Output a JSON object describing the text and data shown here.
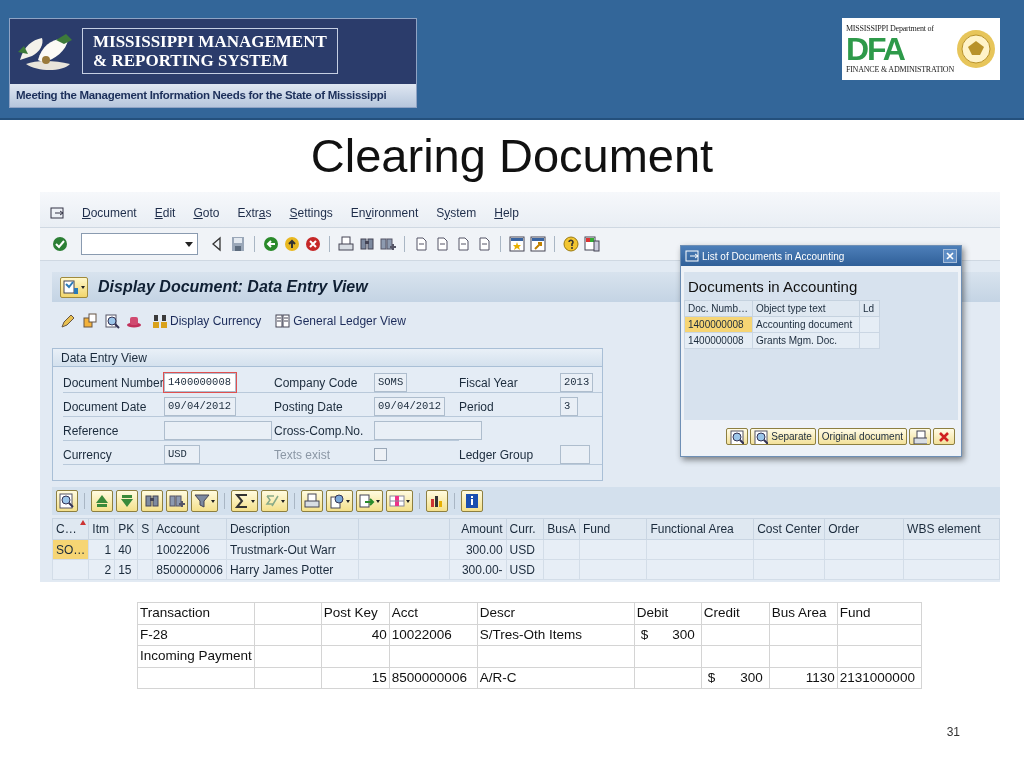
{
  "banner": {
    "title_lines": [
      "MISSISSIPPI MANAGEMENT",
      "& REPORTING SYSTEM"
    ],
    "tagline": "Meeting the Management Information Needs for the State of Mississippi"
  },
  "dfa_logo": {
    "top": "MISSISSIPPI Department of",
    "letters": "DFA",
    "bottom": "FINANCE & ADMINISTRATION"
  },
  "slide_title": "Clearing Document",
  "sap": {
    "menu": [
      {
        "label": "Document"
      },
      {
        "label": "Edit"
      },
      {
        "label": "Goto"
      },
      {
        "label": "Extras"
      },
      {
        "label": "Settings"
      },
      {
        "label": "Environment"
      },
      {
        "label": "System"
      },
      {
        "label": "Help"
      }
    ],
    "screen_title": "Display Document: Data Entry View",
    "app_toolbar": [
      {
        "label": "Display Currency"
      },
      {
        "label": "General Ledger View"
      }
    ],
    "group": {
      "title": "Data Entry View",
      "rows": [
        [
          {
            "kind": "field",
            "label": "Document Number",
            "value": "1400000008",
            "focused": true
          },
          {
            "kind": "field",
            "label": "Company Code",
            "value": "SOMS",
            "focused": false
          },
          {
            "kind": "field",
            "label": "Fiscal Year",
            "value": "2013",
            "focused": false
          }
        ],
        [
          {
            "kind": "field",
            "label": "Document Date",
            "value": "09/04/2012",
            "focused": false
          },
          {
            "kind": "field",
            "label": "Posting Date",
            "value": "09/04/2012",
            "focused": false
          },
          {
            "kind": "field",
            "label": "Period",
            "value": "3",
            "focused": false
          }
        ],
        [
          {
            "kind": "field",
            "label": "Reference",
            "focused": false
          },
          {
            "kind": "field",
            "label": "Cross-Comp.No.",
            "focused": false
          }
        ],
        [
          {
            "kind": "field",
            "label": "Currency",
            "value": "USD",
            "focused": false
          },
          {
            "kind": "checkbox",
            "label": "Texts exist",
            "checked": false,
            "disabled": true
          },
          {
            "kind": "field",
            "label": "Ledger Group",
            "focused": false
          }
        ]
      ]
    },
    "grid": {
      "columns": [
        {
          "label": "C…",
          "sorted": true
        },
        {
          "label": "Itm",
          "sorted": false
        },
        {
          "label": "PK",
          "sorted": false
        },
        {
          "label": "S",
          "sorted": false
        },
        {
          "label": "Account",
          "sorted": false
        },
        {
          "label": "Description",
          "sorted": false
        },
        {
          "sorted": false
        },
        {
          "label": "Amount",
          "sorted": false
        },
        {
          "label": "Curr.",
          "sorted": false
        },
        {
          "label": "BusA",
          "sorted": false
        },
        {
          "label": "Fund",
          "sorted": false
        },
        {
          "label": "Functional Area",
          "sorted": false
        },
        {
          "label": "Cost Center",
          "sorted": false
        },
        {
          "label": "Order",
          "sorted": false
        },
        {
          "label": "WBS element",
          "sorted": false
        }
      ],
      "rows": [
        [
          {
            "text": "SO…",
            "highlighted": true
          },
          {
            "text": "1"
          },
          {
            "text": "40"
          },
          {},
          {
            "text": "10022006"
          },
          {
            "text": "Trustmark-Out Warr"
          },
          {},
          {
            "text": "300.00"
          },
          {
            "text": "USD"
          },
          {},
          {},
          {},
          {},
          {},
          {}
        ],
        [
          {
            "highlighted": false
          },
          {
            "text": "2"
          },
          {
            "text": "15"
          },
          {},
          {
            "text": "8500000006"
          },
          {
            "text": "Harry James Potter"
          },
          {},
          {
            "text": "300.00-"
          },
          {
            "text": "USD"
          },
          {},
          {},
          {},
          {},
          {},
          {}
        ]
      ]
    },
    "popup": {
      "title": "List of Documents in Accounting",
      "heading": "Documents in Accounting",
      "columns": [
        "Doc. Numb…",
        "Object type text",
        "Ld"
      ],
      "rows": [
        {
          "doc": "1400000008",
          "type": "Accounting document",
          "highlighted": true
        },
        {
          "doc": "1400000008",
          "type": "Grants Mgm. Doc.",
          "highlighted": false
        }
      ],
      "buttons": [
        {
          "kind": "icon"
        },
        {
          "kind": "icon_text",
          "label": "Separate"
        },
        {
          "kind": "text",
          "label": "Original document"
        },
        {
          "kind": "print"
        },
        {
          "kind": "cancel"
        }
      ]
    }
  },
  "ledger_table": {
    "columns": [
      {
        "label": "Transaction"
      },
      {},
      {
        "label": "Post Key"
      },
      {
        "label": "Acct"
      },
      {
        "label": "Descr"
      },
      {
        "label": "Debit"
      },
      {
        "label": "Credit"
      },
      {
        "label": "Bus Area"
      },
      {
        "label": "Fund"
      }
    ],
    "rows": [
      [
        {
          "text": "F-28"
        },
        {},
        {
          "text": "40"
        },
        {
          "text": "10022006"
        },
        {
          "text": "S/Tres-Oth Items"
        },
        {
          "currency": "$",
          "amount": "300"
        },
        {},
        {},
        {}
      ],
      [
        {
          "text": "Incoming Payment"
        },
        {},
        {},
        {},
        {},
        {},
        {},
        {},
        {}
      ],
      [
        {},
        {},
        {
          "text": "15"
        },
        {
          "text": "8500000006"
        },
        {
          "text": "A/R-C"
        },
        {},
        {
          "currency": "$",
          "amount": "300"
        },
        {
          "text": "1130"
        },
        {
          "text": "2131000000"
        }
      ]
    ]
  },
  "page_number": "31"
}
